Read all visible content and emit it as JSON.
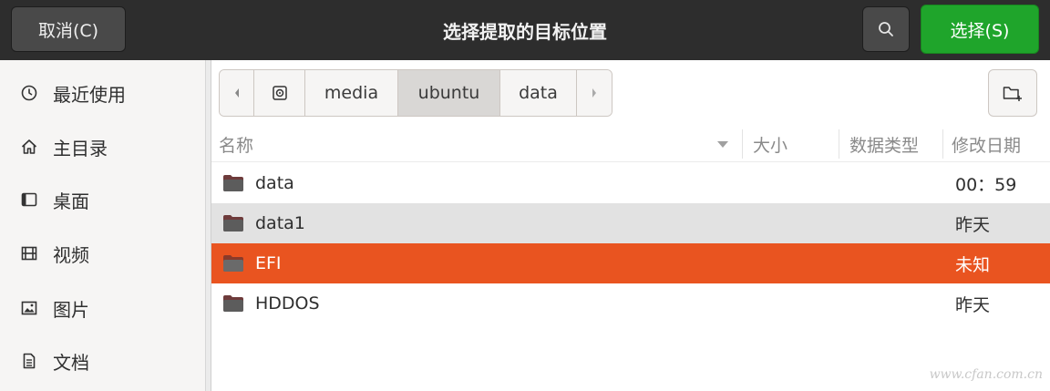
{
  "header": {
    "cancel_label": "取消(C)",
    "title": "选择提取的目标位置",
    "select_label": "选择(S)"
  },
  "sidebar": {
    "items": [
      {
        "label": "最近使用",
        "icon": "clock-icon"
      },
      {
        "label": "主目录",
        "icon": "home-icon"
      },
      {
        "label": "桌面",
        "icon": "desktop-icon"
      },
      {
        "label": "视频",
        "icon": "video-icon"
      },
      {
        "label": "图片",
        "icon": "picture-icon"
      },
      {
        "label": "文档",
        "icon": "document-icon"
      }
    ]
  },
  "pathbar": {
    "segments": [
      "media",
      "ubuntu",
      "data"
    ],
    "active": "ubuntu"
  },
  "columns": {
    "name": "名称",
    "size": "大小",
    "type": "数据类型",
    "modified": "修改日期"
  },
  "files": [
    {
      "name": "data",
      "modified": "00：59"
    },
    {
      "name": "data1",
      "modified": "昨天"
    },
    {
      "name": "EFI",
      "modified": "未知",
      "selected": true
    },
    {
      "name": "HDDOS",
      "modified": "昨天"
    }
  ],
  "watermark": "www.cfan.com.cn",
  "colors": {
    "header_bg": "#2d2d2d",
    "select_button": "#1fa52b",
    "selection": "#e95420",
    "folder": "#6e3b3b"
  }
}
